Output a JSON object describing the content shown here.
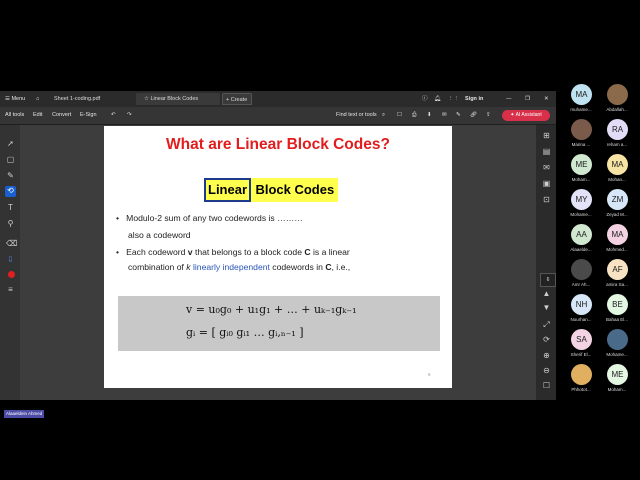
{
  "titlebar": {
    "menu_label": "Menu",
    "tab1": "Sheet 1-coding.pdf",
    "tab2": "Linear Block Codes",
    "create_label": "Create",
    "sign_in": "Sign in"
  },
  "toolbar": {
    "all_tools": "All tools",
    "edit": "Edit",
    "convert": "Convert",
    "esign": "E-Sign",
    "find": "Find text or tools",
    "ai_assistant": "AI Assistant"
  },
  "slide": {
    "title": "What are Linear Block Codes?",
    "highlight_linear": "Linear",
    "highlight_rest": "Block Codes",
    "bullet1_line1": "Modulo-2 sum of any two codewords is ………",
    "bullet1_line2": "also a codeword",
    "bullet2_line1_a": "Each codeword ",
    "bullet2_line1_v": "v",
    "bullet2_line1_b": " that belongs to a block code ",
    "bullet2_line1_c": "C",
    "bullet2_line1_d": " is a linear",
    "bullet2_line2_a": "combination of ",
    "bullet2_line2_k": "k",
    "bullet2_line2_lin": " linearly independent",
    "bullet2_line2_b": " codewords in ",
    "bullet2_line2_c": "C",
    "bullet2_line2_d": ", i.e.,",
    "eq1": "v = u₀g₀ + u₁g₁ + … + uₖ₋₁gₖ₋₁",
    "eq2": "gᵢ = [ gᵢ₀   gᵢ₁   …   gᵢ,ₙ₋₁ ]",
    "page_number": "6"
  },
  "page_badge": "6",
  "speaker_tag": "Alaaeldein Ahmed",
  "participants": [
    {
      "initials": "MA",
      "name": "muhame...",
      "color": "#bfe3f0"
    },
    {
      "initials": "",
      "name": "Abdallah...",
      "color": "#8a6a4a",
      "photo": true
    },
    {
      "initials": "",
      "name": "Marina ...",
      "color": "#7a5a4a",
      "photo": true
    },
    {
      "initials": "RA",
      "name": "reham a...",
      "color": "#e3dcf7"
    },
    {
      "initials": "ME",
      "name": "Moham...",
      "color": "#cfe8cf"
    },
    {
      "initials": "MA",
      "name": "Mohan...",
      "color": "#f7e3a3"
    },
    {
      "initials": "MY",
      "name": "Mohame...",
      "color": "#e3e3f7"
    },
    {
      "initials": "ZM",
      "name": "Zeyad M...",
      "color": "#d7e7f7"
    },
    {
      "initials": "AA",
      "name": "Alaaelde...",
      "color": "#cfe8cf"
    },
    {
      "initials": "MA",
      "name": "Mohmed...",
      "color": "#f3d3e3"
    },
    {
      "initials": "",
      "name": "Amr Ah...",
      "color": "#4a4a4a",
      "photo": true
    },
    {
      "initials": "AF",
      "name": "amira Sa...",
      "color": "#f7e3c3"
    },
    {
      "initials": "NH",
      "name": "Nourhan...",
      "color": "#d7e7f7"
    },
    {
      "initials": "BE",
      "name": "Bahaa El...",
      "color": "#e3f7e3"
    },
    {
      "initials": "SA",
      "name": "Sherif El...",
      "color": "#f3d3e3"
    },
    {
      "initials": "",
      "name": "Mohame...",
      "color": "#4a6a8a",
      "photo": true
    },
    {
      "initials": "",
      "name": "Phhotot...",
      "color": "#e0b060",
      "photo": true
    },
    {
      "initials": "ME",
      "name": "Moham...",
      "color": "#e3f7e3"
    }
  ]
}
